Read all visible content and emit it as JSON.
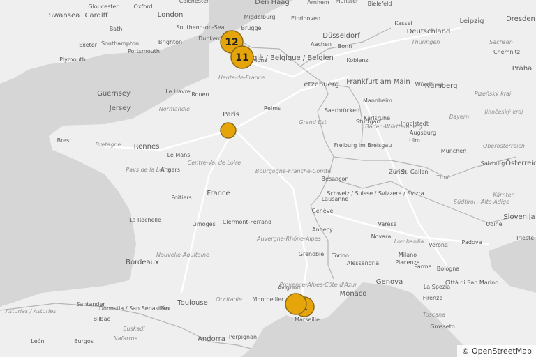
{
  "map": {
    "colors": {
      "sea": "#d6d6d6",
      "land": "#efefef",
      "border": "#b5b5b5",
      "road": "#ffffff",
      "marker_fill": "#e5a50a",
      "marker_stroke": "#8a6a18",
      "label": "#5a5a5a",
      "region_label": "#8e8e8e"
    },
    "attribution": {
      "symbol": "©",
      "text": "OpenStreetMap"
    },
    "city_labels": [
      "Swansea",
      "Cardiff",
      "Gloucester",
      "Oxford",
      "London",
      "Colchester",
      "Den Haag",
      "Arnhem",
      "Münster",
      "Bielefeld",
      "Kassel",
      "Leipzig",
      "Dresden",
      "Bath",
      "Southend-on-Sea",
      "Middelburg",
      "Eindhoven",
      "Düsseldorf",
      "Deutschland",
      "Exeter",
      "Southampton",
      "Brighton",
      "Brugge",
      "Dunkerque",
      "Aachen",
      "Bonn",
      "Thüringen",
      "Sachsen",
      "Plymouth",
      "Portsmouth",
      "België / Belgique / Belgien",
      "Mons",
      "Koblenz",
      "Chemnitz",
      "Praha",
      "Letzebuerg",
      "Frankfurt am Main",
      "Würzburg",
      "Guernsey",
      "Le Havre",
      "Rouen",
      "Hauts-de-France",
      "Nürnberg",
      "Plzeňský kraj",
      "Jersey",
      "Normandie",
      "Paris",
      "Reims",
      "Saarbrücken",
      "Mannheim",
      "Karlsruhe",
      "Ingolstadt",
      "Bayern",
      "Jihočeský kraj",
      "Grand Est",
      "Stuttgart",
      "Baden-Württemberg",
      "Ulm",
      "Augsburg",
      "Brest",
      "Bretagne",
      "Rennes",
      "Freiburg im Breisgau",
      "München",
      "Oberösterreich",
      "Le Mans",
      "Pays de la Loire",
      "Angers",
      "Centre-Val de Loire",
      "Bourgogne-Franche-Comté",
      "Zürich",
      "St. Gallen",
      "Salzburg",
      "Österreich",
      "Tirol",
      "Besançon",
      "Schweiz / Suisse / Svizzera / Svizra",
      "Südtirol - Alto Adige",
      "France",
      "Poitiers",
      "Lausanne",
      "Genève",
      "Kärnten",
      "Clermont-Ferrand",
      "La Rochelle",
      "Limoges",
      "Annecy",
      "Varese",
      "Udine",
      "Slovenija",
      "Auvergne-Rhône-Alpes",
      "Novara",
      "Verona",
      "Padova",
      "Lombardia",
      "Milano",
      "Torino",
      "Trieste",
      "Nouvelle-Aquitaine",
      "Bordeaux",
      "Grenoble",
      "Piacenza",
      "Alessandria",
      "Parma",
      "Bologna",
      "Genova",
      "Avignon",
      "Provence-Alpes-Côte d'Azur",
      "La Spezia",
      "Città di San Marino",
      "Toulouse",
      "Montpellier",
      "Monaco",
      "Occitanie",
      "Santander",
      "Donostia / San Sebastián",
      "Pau",
      "Firenze",
      "Asturias / Asturies",
      "Bilbao",
      "Euskadi",
      "Marseille",
      "Toscana",
      "Nafarroa",
      "Perpignan",
      "Andorra",
      "León",
      "Burgos",
      "Grosseto"
    ],
    "markers": [
      {
        "label": "12",
        "kind": "cluster"
      },
      {
        "label": "11",
        "kind": "cluster"
      },
      {
        "label": "",
        "kind": "point"
      },
      {
        "label": "2",
        "kind": "cluster"
      },
      {
        "label": "",
        "kind": "point"
      }
    ]
  }
}
